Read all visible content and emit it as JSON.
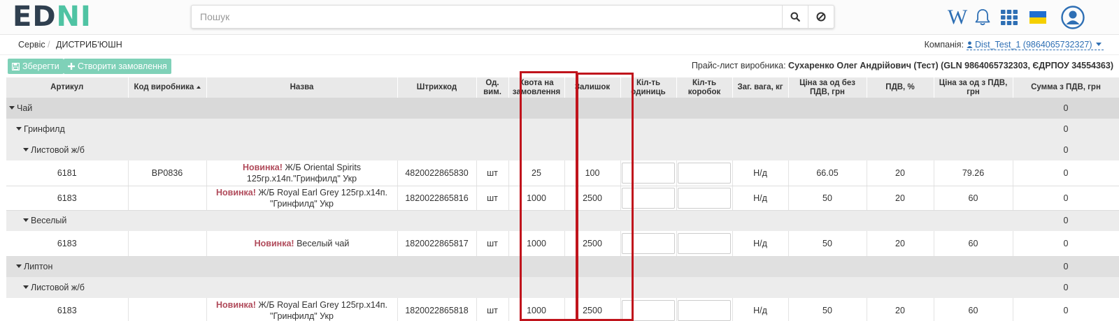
{
  "logo": {
    "part1": "ED",
    "part2": "NI",
    "color_dark": "#2f3f4f",
    "color_accent": "#4fc3a3"
  },
  "search": {
    "placeholder": "Пошук",
    "value": "",
    "search_icon": "search-icon",
    "clear_icon": "cancel-icon"
  },
  "topbar": {
    "wiki_label": "W",
    "icons": [
      "wiki-icon",
      "bell-icon",
      "apps-grid-icon",
      "ukraine-flag-icon",
      "user-avatar-icon"
    ]
  },
  "breadcrumb": {
    "items": [
      "Сервіс",
      "ДИСТРИБ'ЮШН"
    ],
    "separator": "/"
  },
  "company": {
    "label": "Компанія:",
    "value": "Dist_Test_1 (9864065732327)"
  },
  "actions": {
    "save_label": "Зберегти",
    "create_order_label": "Створити замовлення"
  },
  "pricelist": {
    "label": "Прайс-лист виробника:",
    "value": "Сухаренко Олег Андрійович (Тест) (GLN 9864065732303, ЄДРПОУ 34554363)"
  },
  "table": {
    "columns": [
      "Артикул",
      "Код виробника",
      "Назва",
      "Штрихкод",
      "Од. вим.",
      "Квота на замовлення",
      "Залишок",
      "Кіл-ть одиниць",
      "Кіл-ть коробок",
      "Заг. вага, кг",
      "Ціна за од без ПДВ, грн",
      "ПДВ, %",
      "Ціна за од з ПДВ, грн",
      "Сумма з ПДВ, грн"
    ],
    "sorted_column": "Код виробника",
    "new_badge": "Новинка!",
    "groups": {
      "g1": {
        "label": "Чай",
        "sum": "0"
      },
      "g1a": {
        "label": "Гринфилд",
        "sum": "0"
      },
      "g1a1": {
        "label": "Листовой ж/б",
        "sum": "0"
      },
      "g1b": {
        "label": "Веселый",
        "sum": "0"
      },
      "g2": {
        "label": "Липтон",
        "sum": "0"
      },
      "g2a": {
        "label": "Листовой ж/б",
        "sum": "0"
      }
    },
    "rows": [
      {
        "article": "6181",
        "code": "BP0836",
        "name": "Ж/Б Oriental Spirits 125гр.х14п.\"Гринфилд\" Укр",
        "barcode": "4820022865830",
        "unit": "шт",
        "quota": "25",
        "stock": "100",
        "weight": "Н/д",
        "price_no_vat": "66.05",
        "vat": "20",
        "price_vat": "79.26",
        "sum": "0"
      },
      {
        "article": "6183",
        "code": "",
        "name": "Ж/Б Royal Earl Grey 125гр.х14п. \"Гринфилд\" Укр",
        "barcode": "1820022865816",
        "unit": "шт",
        "quota": "1000",
        "stock": "2500",
        "weight": "Н/д",
        "price_no_vat": "50",
        "vat": "20",
        "price_vat": "60",
        "sum": "0"
      },
      {
        "article": "6183",
        "code": "",
        "name": "Веселый чай",
        "barcode": "1820022865817",
        "unit": "шт",
        "quota": "1000",
        "stock": "2500",
        "weight": "Н/д",
        "price_no_vat": "50",
        "vat": "20",
        "price_vat": "60",
        "sum": "0"
      },
      {
        "article": "6183",
        "code": "",
        "name": "Ж/Б Royal Earl Grey 125гр.х14п. \"Гринфилд\" Укр",
        "barcode": "1820022865818",
        "unit": "шт",
        "quota": "1000",
        "stock": "2500",
        "weight": "Н/д",
        "price_no_vat": "50",
        "vat": "20",
        "price_vat": "60",
        "sum": "0"
      }
    ]
  },
  "highlight_color": "#c0141c"
}
